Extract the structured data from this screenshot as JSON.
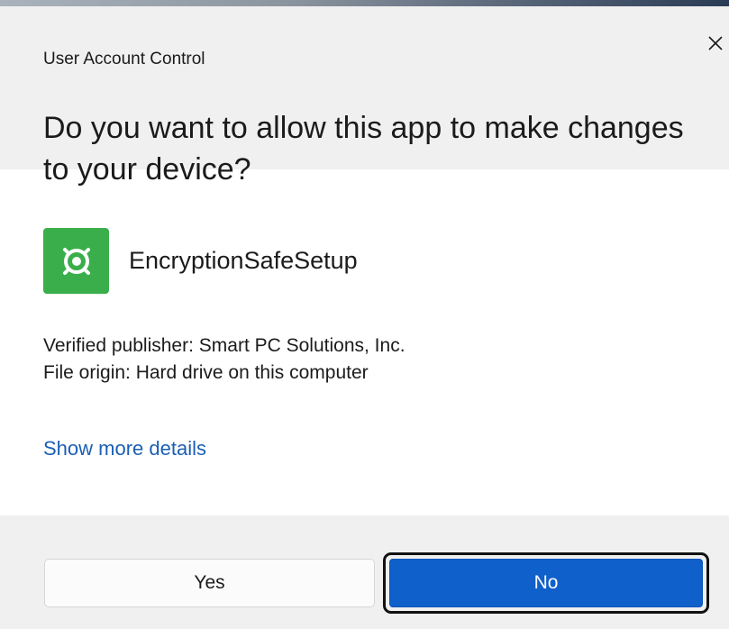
{
  "dialog": {
    "title": "User Account Control",
    "question": "Do you want to allow this app to make changes to your device?",
    "close_icon": "close-icon"
  },
  "app": {
    "name": "EncryptionSafeSetup",
    "icon": "encryption-safe-app-icon",
    "icon_color": "#3aae4a"
  },
  "details": {
    "publisher": "Verified publisher: Smart PC Solutions, Inc.",
    "origin": "File origin: Hard drive on this computer"
  },
  "links": {
    "more_details": "Show more details"
  },
  "buttons": {
    "yes": "Yes",
    "no": "No"
  },
  "colors": {
    "accent": "#1060cb",
    "link": "#1a5fb4",
    "panel": "#f0f0f0"
  }
}
